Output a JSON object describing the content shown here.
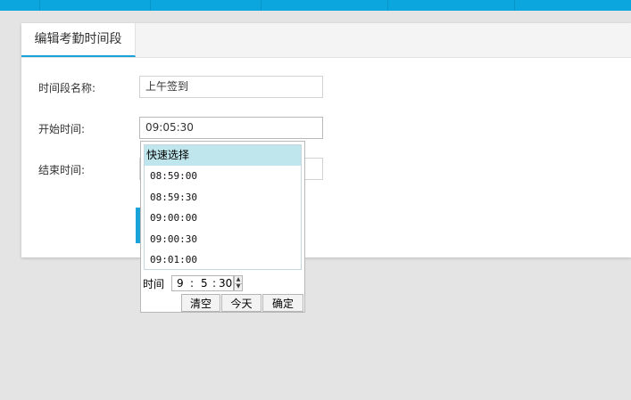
{
  "tab": {
    "label": "编辑考勤时间段"
  },
  "form": {
    "name_label": "时间段名称:",
    "name_value": "上午签到",
    "start_label": "开始时间:",
    "start_value": "09:05:30",
    "end_label": "结束时间:",
    "end_value": ""
  },
  "picker": {
    "quick_select_title": "快速选择",
    "quick_times": [
      "08:59:00",
      "08:59:30",
      "09:00:00",
      "09:00:30",
      "09:01:00"
    ],
    "time_label": "时间",
    "hour": "9",
    "minute": "5",
    "second": "30",
    "sep": ":",
    "clear_label": "清空",
    "today_label": "今天",
    "ok_label": "确定"
  },
  "colors": {
    "accent": "#1aa3d8",
    "topbar": "#0aa6dd",
    "quick_header": "#bfe6ec"
  },
  "icons": {
    "spin_up": "triangle-up-icon",
    "spin_down": "triangle-down-icon"
  }
}
